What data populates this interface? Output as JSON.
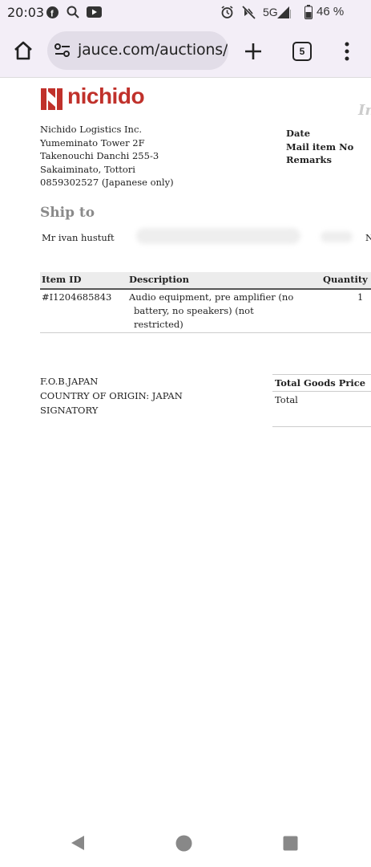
{
  "status_bar": {
    "time": "20:03",
    "network": "5G",
    "battery": "46 %",
    "icons": [
      "facebook-icon",
      "search-icon",
      "youtube-icon",
      "alarm-icon",
      "mute-icon",
      "signal-icon",
      "battery-icon"
    ]
  },
  "browser": {
    "url": "jauce.com/auctions/u",
    "tab_count": "5",
    "icons": [
      "home-icon",
      "site-settings-icon",
      "new-tab-icon",
      "tab-switcher-icon",
      "menu-icon"
    ]
  },
  "document": {
    "logo_text": "nichido",
    "ghost_heading": "In",
    "sender": {
      "lines": [
        "Nichido Logistics Inc.",
        "Yumeminato Tower 2F",
        "Takenouchi Danchi 255-3",
        "Sakaiminato, Tottori",
        "0859302527 (Japanese only)"
      ]
    },
    "meta": {
      "date_label": "Date",
      "mail_item_label": "Mail item No",
      "remarks_label": "Remarks"
    },
    "ship_to": {
      "heading": "Ship to",
      "name": "Mr ivan hustuft",
      "right_cut": "N"
    },
    "items_table": {
      "headers": [
        "Item ID",
        "Description",
        "Quantity"
      ],
      "rows": [
        {
          "item_id": "#I1204685843",
          "description": [
            "Audio equipment, pre amplifier (no",
            "battery, no speakers) (not",
            "restricted)"
          ],
          "quantity": "1"
        }
      ]
    },
    "footer": {
      "lines": [
        "F.O.B.JAPAN",
        "COUNTRY OF ORIGIN: JAPAN",
        "SIGNATORY"
      ]
    },
    "totals": {
      "goods_price_label": "Total Goods Price",
      "total_label": "Total"
    }
  },
  "nav_bar": {
    "icons": [
      "back-icon",
      "home-circle-icon",
      "recents-icon"
    ]
  },
  "colors": {
    "brand": "#c0312b",
    "chrome_bg": "#f3eef7"
  }
}
